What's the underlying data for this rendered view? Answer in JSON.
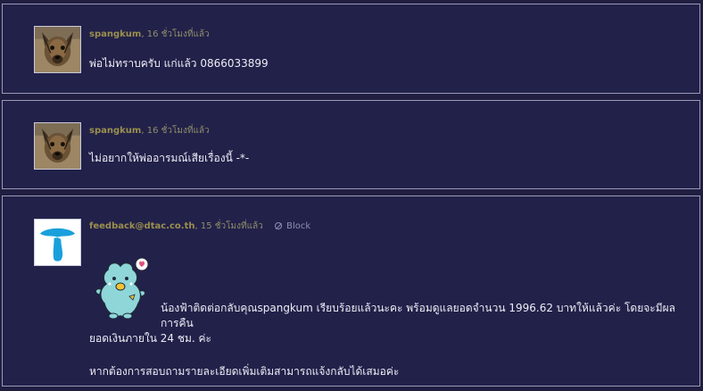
{
  "comments": [
    {
      "author": "spangkum",
      "time": "16 ชั่วโมงที่แล้ว",
      "text": "พ่อไม่ทราบครับ แก่แล้ว 0866033899",
      "avatar_icon": "dog-photo-avatar"
    },
    {
      "author": "spangkum",
      "time": "16 ชั่วโมงที่แล้ว",
      "text": "ไม่อยากให้พ่ออารมณ์เสียเรื่องนี้ -*-",
      "avatar_icon": "dog-photo-avatar"
    },
    {
      "author": "feedback@dtac.co.th",
      "time": "15 ชั่วโมงที่แล้ว",
      "block_label": "Block",
      "avatar_icon": "dtac-logo",
      "sticker_icon": "dtac-mascot-sticker",
      "text_line1": "น้องฟ้าติดต่อกลับคุณspangkum เรียบร้อยแล้วนะคะ พร้อมดูแลยอดจำนวน 1996.62 บาทให้แล้วค่ะ โดยจะมีผลการคืน",
      "text_line2": "ยอดเงินภายใน 24 ชม. ค่ะ",
      "text_line3": "หากต้องการสอบถามรายละเอียดเพิ่มเติมสามารถแจ้งกลับได้เสมอค่ะ"
    }
  ],
  "separator": ",",
  "colors": {
    "background": "#201f42",
    "border": "#9a99b6",
    "author": "#9b8f4e",
    "text": "#ececf4",
    "dtac_blue": "#19a0dc"
  }
}
